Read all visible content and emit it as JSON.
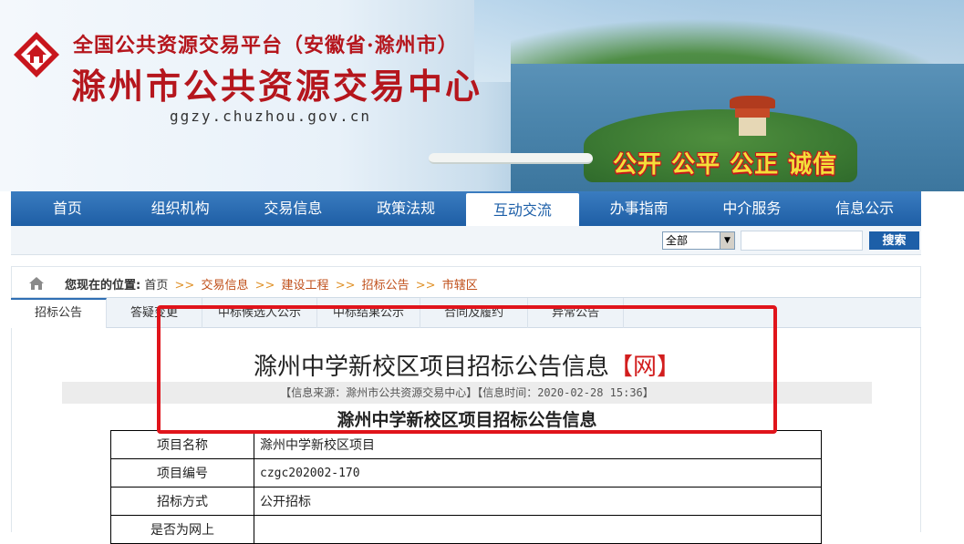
{
  "header": {
    "platform_title": "全国公共资源交易平台（安徽省·滁州市）",
    "site_title": "滁州市公共资源交易中心",
    "url": "ggzy.chuzhou.gov.cn",
    "slogan": "公开  公平  公正  诚信",
    "logo_icon": "house-diamond-logo-icon",
    "brand_color": "#b5161d"
  },
  "nav": {
    "items": [
      {
        "label": "首页"
      },
      {
        "label": "组织机构"
      },
      {
        "label": "交易信息"
      },
      {
        "label": "政策法规"
      },
      {
        "label": "互动交流"
      },
      {
        "label": "办事指南"
      },
      {
        "label": "中介服务"
      },
      {
        "label": "信息公示"
      }
    ],
    "active_index": 4,
    "color": "#1e5ea5"
  },
  "search": {
    "select_value": "全部",
    "input_value": "",
    "button_label": "搜索"
  },
  "breadcrumb": {
    "lead": "您现在的位置:",
    "items": [
      "首页",
      "交易信息",
      "建设工程",
      "招标公告",
      "市辖区"
    ],
    "separator": ">>"
  },
  "tabs": {
    "items": [
      "招标公告",
      "答疑变更",
      "中标候选人公示",
      "中标结果公示",
      "合同及履约",
      "异常公告"
    ],
    "active_index": 0
  },
  "article": {
    "title": "滁州中学新校区项目招标公告信息",
    "title_tag": "【网】",
    "meta": "【信息来源：滁州市公共资源交易中心】【信息时间：2020-02-28 15:36】",
    "subtitle": "滁州中学新校区项目招标公告信息",
    "table": [
      {
        "key": "项目名称",
        "value": "滁州中学新校区项目"
      },
      {
        "key": "项目编号",
        "value": "czgc202002-170"
      },
      {
        "key": "招标方式",
        "value": "公开招标"
      },
      {
        "key": "是否为网上",
        "value": ""
      }
    ]
  },
  "highlight_color": "#e0141b"
}
